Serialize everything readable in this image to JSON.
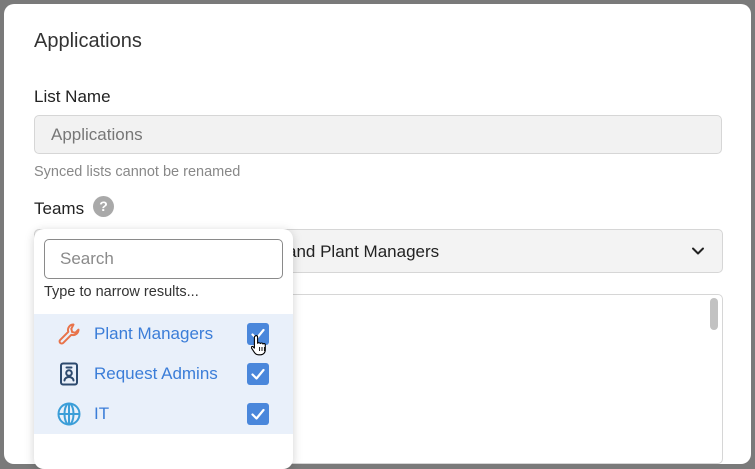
{
  "modal": {
    "title": "Applications"
  },
  "list_name": {
    "label": "List Name",
    "value": "Applications",
    "help_text": "Synced lists cannot be renamed"
  },
  "teams": {
    "label": "Teams",
    "help_icon": "question-mark-icon",
    "help_icon_text": "?",
    "selected_text": "and Plant Managers",
    "dropdown": {
      "search_placeholder": "Search",
      "search_hint": "Type to narrow results...",
      "options": [
        {
          "label": "Plant Managers",
          "icon": "wrench-icon",
          "icon_color": "#e8734a",
          "checked": true
        },
        {
          "label": "Request Admins",
          "icon": "id-badge-icon",
          "icon_color": "#2d4a6e",
          "checked": true
        },
        {
          "label": "IT",
          "icon": "globe-icon",
          "icon_color": "#3b9ed8",
          "checked": true
        }
      ]
    }
  },
  "colors": {
    "accent": "#4a87db",
    "option_highlight": "#e9f0fa",
    "link_text": "#3b7dd8"
  }
}
